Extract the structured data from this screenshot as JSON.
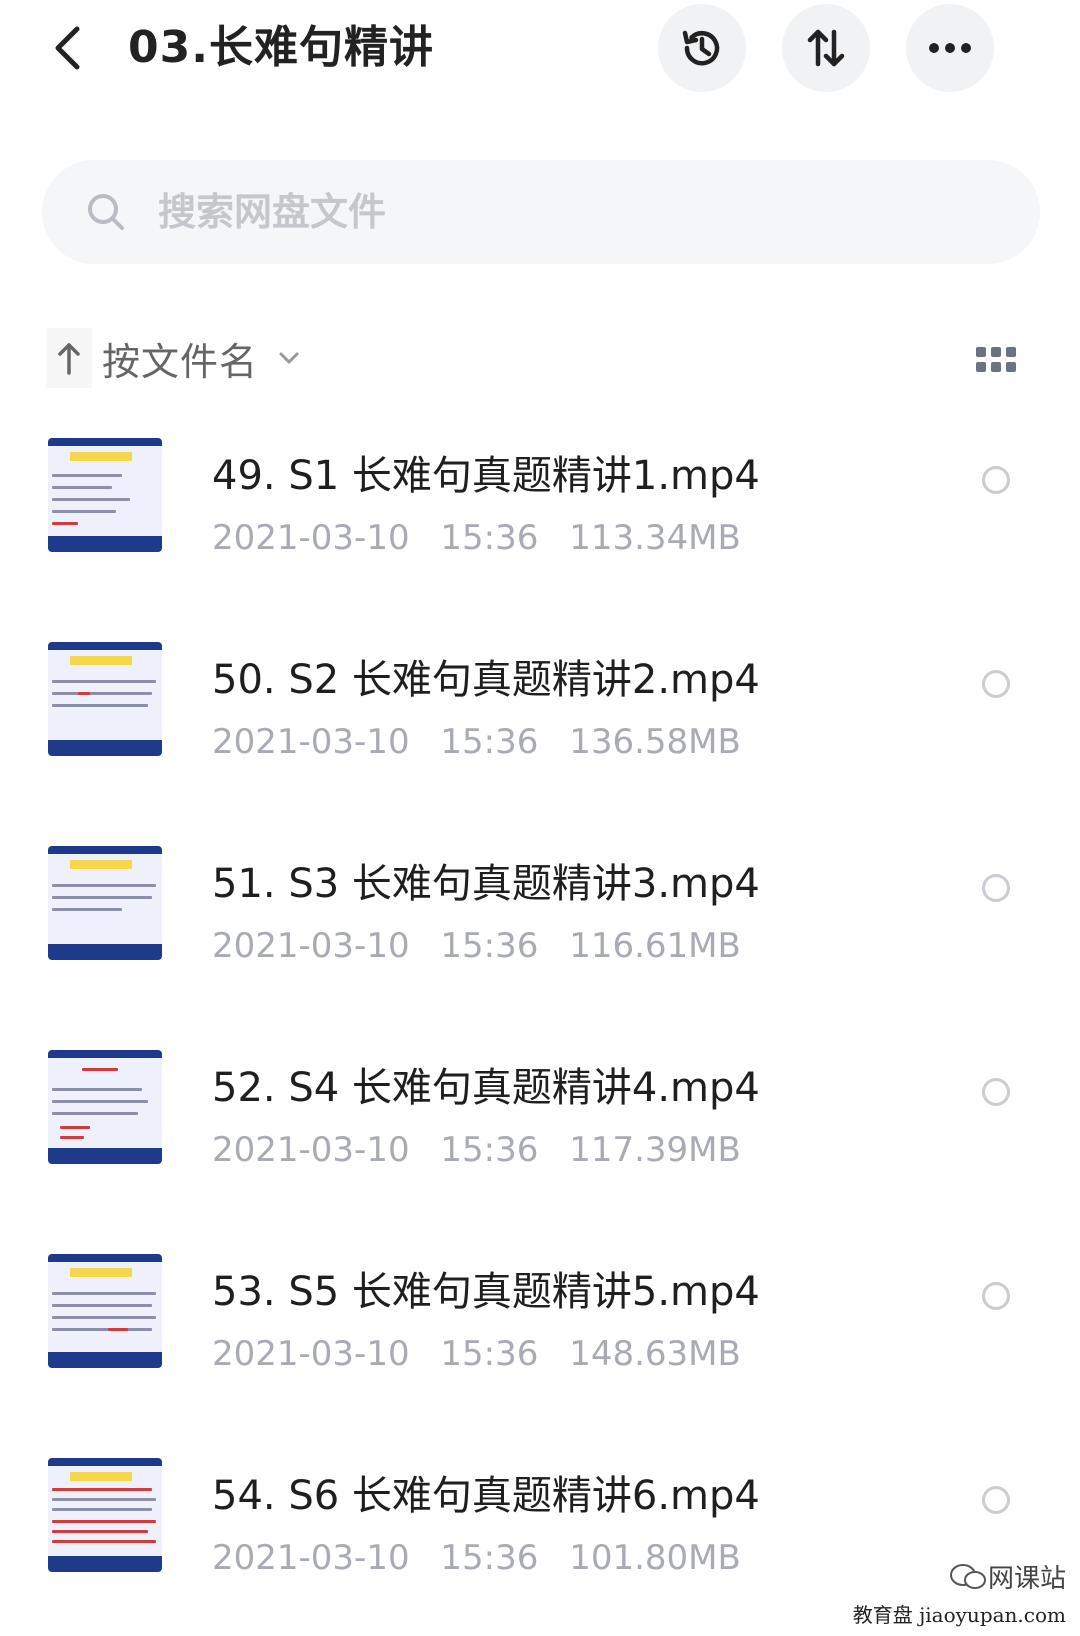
{
  "header": {
    "title": "03.长难句精讲",
    "icons": [
      "back-arrow-icon",
      "history-icon",
      "sort-arrows-icon",
      "more-dots-icon"
    ]
  },
  "search": {
    "placeholder": "搜索网盘文件"
  },
  "sort": {
    "label": "按文件名",
    "direction": "ascending"
  },
  "files": [
    {
      "name": "49. S1 长难句真题精讲1.mp4",
      "date": "2021-03-10",
      "time": "15:36",
      "size": "113.34MB"
    },
    {
      "name": "50. S2 长难句真题精讲2.mp4",
      "date": "2021-03-10",
      "time": "15:36",
      "size": "136.58MB"
    },
    {
      "name": "51. S3 长难句真题精讲3.mp4",
      "date": "2021-03-10",
      "time": "15:36",
      "size": "116.61MB"
    },
    {
      "name": "52. S4 长难句真题精讲4.mp4",
      "date": "2021-03-10",
      "time": "15:36",
      "size": "117.39MB"
    },
    {
      "name": "53. S5 长难句真题精讲5.mp4",
      "date": "2021-03-10",
      "time": "15:36",
      "size": "148.63MB"
    },
    {
      "name": "54. S6 长难句真题精讲6.mp4",
      "date": "2021-03-10",
      "time": "15:36",
      "size": "101.80MB"
    }
  ],
  "watermark": {
    "line1": "网课站",
    "line2": "教育盘 jiaoyupan.com"
  },
  "colors": {
    "text_primary": "#1f1f1f",
    "text_meta": "#a8abb3",
    "icon_bg": "#f1f2f4",
    "thumb_border": "#1e3a8a",
    "thumb_highlight": "#f6d64a"
  }
}
